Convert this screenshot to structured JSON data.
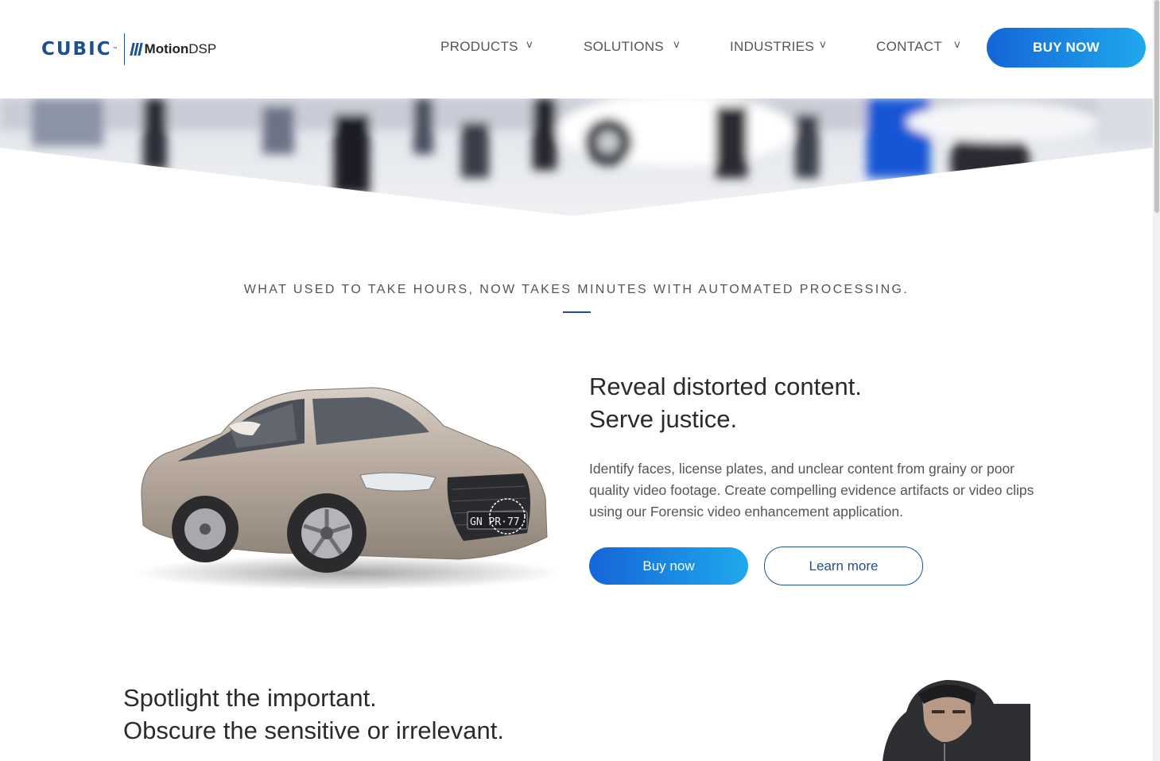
{
  "brand": {
    "cubic": "CUBIC",
    "tm": "™",
    "motion": "Motion",
    "dsp": "DSP"
  },
  "nav": {
    "items": [
      {
        "label": "PRODUCTS",
        "caret": "v"
      },
      {
        "label": "SOLUTIONS",
        "caret": "v"
      },
      {
        "label": "INDUSTRIES",
        "caret": "v"
      },
      {
        "label": "CONTACT",
        "caret": "v"
      }
    ],
    "buy_label": "BUY NOW"
  },
  "tagline": "WHAT USED TO TAKE HOURS, NOW TAKES MINUTES WITH AUTOMATED PROCESSING.",
  "feature1": {
    "title_line1": "Reveal distorted content.",
    "title_line2": "Serve justice.",
    "body": "Identify faces, license plates, and unclear content from grainy or poor quality video footage. Create compelling evidence artifacts or video clips using our Forensic video enhancement application.",
    "buy_label": "Buy now",
    "learn_label": "Learn more",
    "plate_text": "GN PR·77"
  },
  "feature2": {
    "title_line1": "Spotlight the important.",
    "title_line2": "Obscure the sensitive or irrelevant."
  },
  "colors": {
    "brand_blue": "#1d4f91",
    "button_gradient_start": "#1565d8",
    "button_gradient_end": "#1fa9ec"
  }
}
